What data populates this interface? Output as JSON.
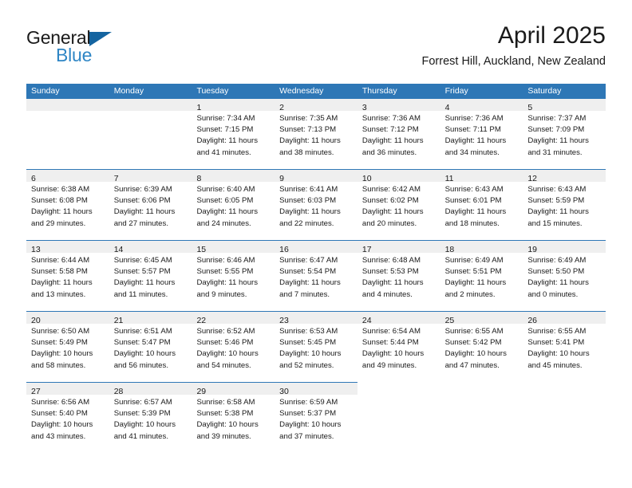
{
  "brand": {
    "line1": "General",
    "line2": "Blue",
    "triangle_color": "#1464a0",
    "blue_text_color": "#2f86c5"
  },
  "header": {
    "title": "April 2025",
    "subtitle": "Forrest Hill, Auckland, New Zealand"
  },
  "colors": {
    "header_blue": "#2e77b6",
    "daynum_band": "#efefef",
    "text": "#1a1a1a"
  },
  "calendar": {
    "weekdays": [
      "Sunday",
      "Monday",
      "Tuesday",
      "Wednesday",
      "Thursday",
      "Friday",
      "Saturday"
    ],
    "weeks": [
      [
        {
          "day": "",
          "lines": []
        },
        {
          "day": "",
          "lines": []
        },
        {
          "day": "1",
          "lines": [
            "Sunrise: 7:34 AM",
            "Sunset: 7:15 PM",
            "Daylight: 11 hours",
            "and 41 minutes."
          ]
        },
        {
          "day": "2",
          "lines": [
            "Sunrise: 7:35 AM",
            "Sunset: 7:13 PM",
            "Daylight: 11 hours",
            "and 38 minutes."
          ]
        },
        {
          "day": "3",
          "lines": [
            "Sunrise: 7:36 AM",
            "Sunset: 7:12 PM",
            "Daylight: 11 hours",
            "and 36 minutes."
          ]
        },
        {
          "day": "4",
          "lines": [
            "Sunrise: 7:36 AM",
            "Sunset: 7:11 PM",
            "Daylight: 11 hours",
            "and 34 minutes."
          ]
        },
        {
          "day": "5",
          "lines": [
            "Sunrise: 7:37 AM",
            "Sunset: 7:09 PM",
            "Daylight: 11 hours",
            "and 31 minutes."
          ]
        }
      ],
      [
        {
          "day": "6",
          "lines": [
            "Sunrise: 6:38 AM",
            "Sunset: 6:08 PM",
            "Daylight: 11 hours",
            "and 29 minutes."
          ]
        },
        {
          "day": "7",
          "lines": [
            "Sunrise: 6:39 AM",
            "Sunset: 6:06 PM",
            "Daylight: 11 hours",
            "and 27 minutes."
          ]
        },
        {
          "day": "8",
          "lines": [
            "Sunrise: 6:40 AM",
            "Sunset: 6:05 PM",
            "Daylight: 11 hours",
            "and 24 minutes."
          ]
        },
        {
          "day": "9",
          "lines": [
            "Sunrise: 6:41 AM",
            "Sunset: 6:03 PM",
            "Daylight: 11 hours",
            "and 22 minutes."
          ]
        },
        {
          "day": "10",
          "lines": [
            "Sunrise: 6:42 AM",
            "Sunset: 6:02 PM",
            "Daylight: 11 hours",
            "and 20 minutes."
          ]
        },
        {
          "day": "11",
          "lines": [
            "Sunrise: 6:43 AM",
            "Sunset: 6:01 PM",
            "Daylight: 11 hours",
            "and 18 minutes."
          ]
        },
        {
          "day": "12",
          "lines": [
            "Sunrise: 6:43 AM",
            "Sunset: 5:59 PM",
            "Daylight: 11 hours",
            "and 15 minutes."
          ]
        }
      ],
      [
        {
          "day": "13",
          "lines": [
            "Sunrise: 6:44 AM",
            "Sunset: 5:58 PM",
            "Daylight: 11 hours",
            "and 13 minutes."
          ]
        },
        {
          "day": "14",
          "lines": [
            "Sunrise: 6:45 AM",
            "Sunset: 5:57 PM",
            "Daylight: 11 hours",
            "and 11 minutes."
          ]
        },
        {
          "day": "15",
          "lines": [
            "Sunrise: 6:46 AM",
            "Sunset: 5:55 PM",
            "Daylight: 11 hours",
            "and 9 minutes."
          ]
        },
        {
          "day": "16",
          "lines": [
            "Sunrise: 6:47 AM",
            "Sunset: 5:54 PM",
            "Daylight: 11 hours",
            "and 7 minutes."
          ]
        },
        {
          "day": "17",
          "lines": [
            "Sunrise: 6:48 AM",
            "Sunset: 5:53 PM",
            "Daylight: 11 hours",
            "and 4 minutes."
          ]
        },
        {
          "day": "18",
          "lines": [
            "Sunrise: 6:49 AM",
            "Sunset: 5:51 PM",
            "Daylight: 11 hours",
            "and 2 minutes."
          ]
        },
        {
          "day": "19",
          "lines": [
            "Sunrise: 6:49 AM",
            "Sunset: 5:50 PM",
            "Daylight: 11 hours",
            "and 0 minutes."
          ]
        }
      ],
      [
        {
          "day": "20",
          "lines": [
            "Sunrise: 6:50 AM",
            "Sunset: 5:49 PM",
            "Daylight: 10 hours",
            "and 58 minutes."
          ]
        },
        {
          "day": "21",
          "lines": [
            "Sunrise: 6:51 AM",
            "Sunset: 5:47 PM",
            "Daylight: 10 hours",
            "and 56 minutes."
          ]
        },
        {
          "day": "22",
          "lines": [
            "Sunrise: 6:52 AM",
            "Sunset: 5:46 PM",
            "Daylight: 10 hours",
            "and 54 minutes."
          ]
        },
        {
          "day": "23",
          "lines": [
            "Sunrise: 6:53 AM",
            "Sunset: 5:45 PM",
            "Daylight: 10 hours",
            "and 52 minutes."
          ]
        },
        {
          "day": "24",
          "lines": [
            "Sunrise: 6:54 AM",
            "Sunset: 5:44 PM",
            "Daylight: 10 hours",
            "and 49 minutes."
          ]
        },
        {
          "day": "25",
          "lines": [
            "Sunrise: 6:55 AM",
            "Sunset: 5:42 PM",
            "Daylight: 10 hours",
            "and 47 minutes."
          ]
        },
        {
          "day": "26",
          "lines": [
            "Sunrise: 6:55 AM",
            "Sunset: 5:41 PM",
            "Daylight: 10 hours",
            "and 45 minutes."
          ]
        }
      ],
      [
        {
          "day": "27",
          "lines": [
            "Sunrise: 6:56 AM",
            "Sunset: 5:40 PM",
            "Daylight: 10 hours",
            "and 43 minutes."
          ]
        },
        {
          "day": "28",
          "lines": [
            "Sunrise: 6:57 AM",
            "Sunset: 5:39 PM",
            "Daylight: 10 hours",
            "and 41 minutes."
          ]
        },
        {
          "day": "29",
          "lines": [
            "Sunrise: 6:58 AM",
            "Sunset: 5:38 PM",
            "Daylight: 10 hours",
            "and 39 minutes."
          ]
        },
        {
          "day": "30",
          "lines": [
            "Sunrise: 6:59 AM",
            "Sunset: 5:37 PM",
            "Daylight: 10 hours",
            "and 37 minutes."
          ]
        },
        {
          "day": "",
          "lines": []
        },
        {
          "day": "",
          "lines": []
        },
        {
          "day": "",
          "lines": []
        }
      ]
    ]
  }
}
